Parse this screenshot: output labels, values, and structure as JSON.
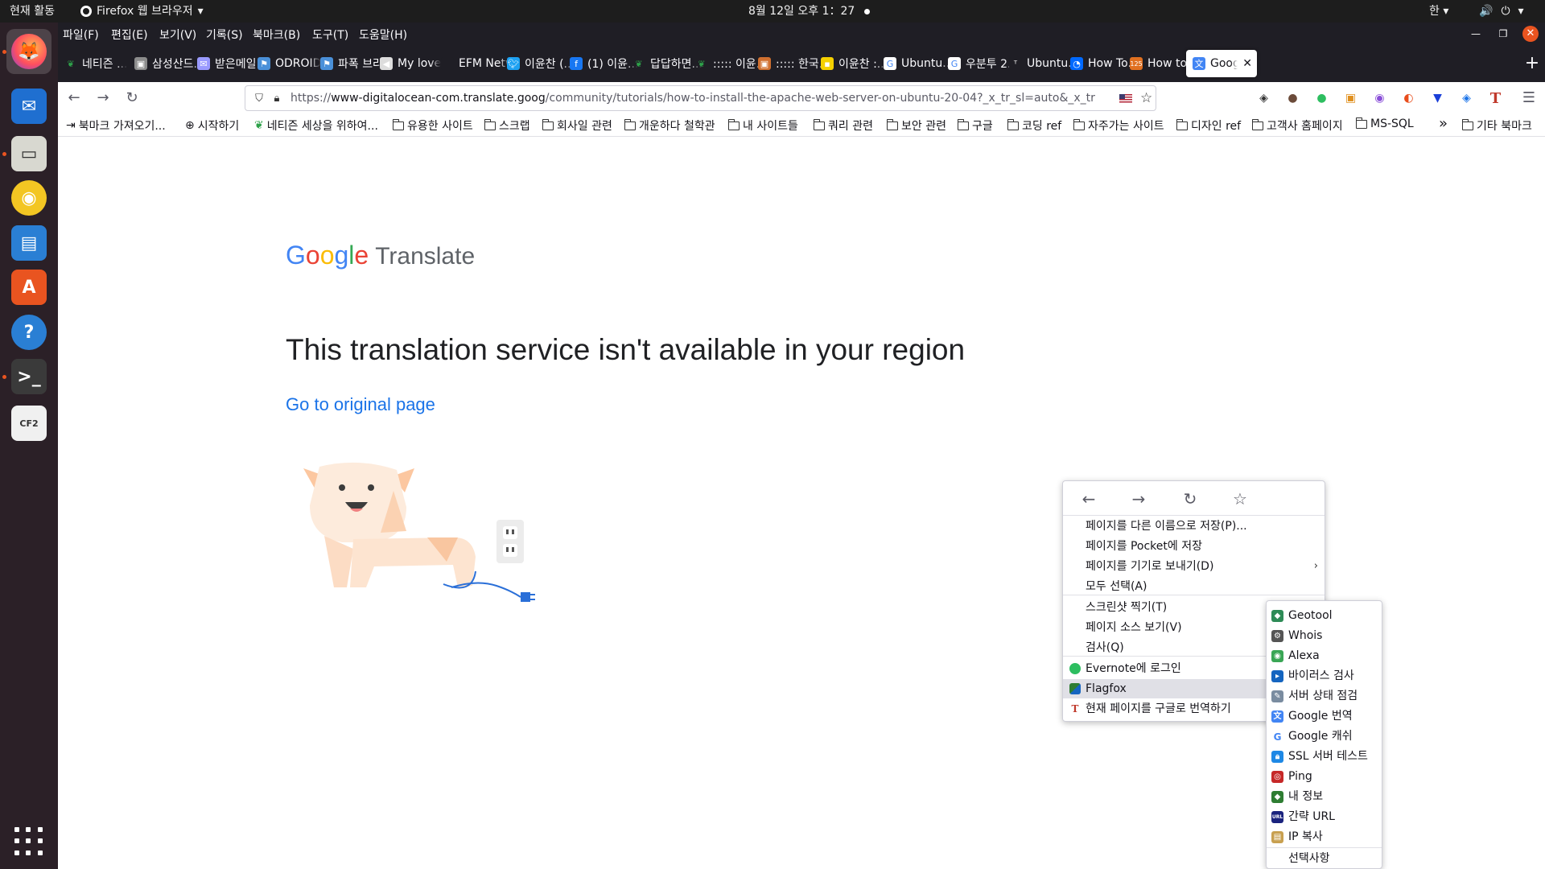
{
  "topbar": {
    "activities": "현재 활동",
    "app_menu": "Firefox 웹 브라우저",
    "clock": "8월 12일 오후 1：27",
    "input_method": "한"
  },
  "dock": {
    "apps": [
      {
        "name": "firefox-icon",
        "label": "Firefox",
        "color": "#ff7139"
      },
      {
        "name": "thunderbird-icon",
        "label": "Thunderbird",
        "color": "#1f6fd0"
      },
      {
        "name": "files-icon",
        "label": "Files",
        "color": "#d8d8d0"
      },
      {
        "name": "rhythmbox-icon",
        "label": "Rhythmbox",
        "color": "#f3c623"
      },
      {
        "name": "writer-icon",
        "label": "LibreOffice Writer",
        "color": "#2a7fd4"
      },
      {
        "name": "software-icon",
        "label": "Ubuntu Software",
        "color": "#e95420"
      },
      {
        "name": "help-icon",
        "label": "Help",
        "color": "#2a7fd4"
      },
      {
        "name": "terminal-icon",
        "label": "Terminal",
        "color": "#3a3a3a"
      },
      {
        "name": "cf2-icon",
        "label": "CF2",
        "color": "#f0f0f0"
      }
    ]
  },
  "menubar": {
    "items": [
      "파일(F)",
      "편집(E)",
      "보기(V)",
      "기록(S)",
      "북마크(B)",
      "도구(T)",
      "도움말(H)"
    ]
  },
  "tabs": [
    {
      "title": "네티즌 ...",
      "favicon": "sprout",
      "color": "#2ea24a"
    },
    {
      "title": "삼성산드...",
      "favicon": "image",
      "color": "#8c8c8c"
    },
    {
      "title": "받은메일...",
      "favicon": "mail",
      "color": "#9a9aff"
    },
    {
      "title": "ODROID",
      "favicon": "odroid",
      "color": "#4a90d9"
    },
    {
      "title": "파폭 브라...",
      "favicon": "odroid",
      "color": "#4a90d9"
    },
    {
      "title": "My love",
      "favicon": "speaker",
      "color": "#dddddd"
    },
    {
      "title": "EFM Netw...",
      "favicon": "none",
      "color": "#1f1e25"
    },
    {
      "title": "이윤찬 (...",
      "favicon": "twitter",
      "color": "#1da1f2"
    },
    {
      "title": "(1) 이윤...",
      "favicon": "facebook",
      "color": "#1877f2"
    },
    {
      "title": "답답하면...",
      "favicon": "sprout",
      "color": "#2ea24a"
    },
    {
      "title": "::::: 이윤...",
      "favicon": "sprout",
      "color": "#2ea24a"
    },
    {
      "title": "::::: 한국...",
      "favicon": "image",
      "color": "#d07030"
    },
    {
      "title": "이윤찬 :...",
      "favicon": "note",
      "color": "#f5d000"
    },
    {
      "title": "Ubuntu...",
      "favicon": "google",
      "color": "#ffffff"
    },
    {
      "title": "우분투 2...",
      "favicon": "google",
      "color": "#ffffff"
    },
    {
      "title": "Ubuntu...",
      "favicon": "t",
      "color": "#1f1e25"
    },
    {
      "title": "How To...",
      "favicon": "do",
      "color": "#0069ff"
    },
    {
      "title": "How to...",
      "favicon": "125",
      "color": "#e07020"
    },
    {
      "title": "Goog...",
      "favicon": "translate",
      "color": "#4285f4",
      "selected": true
    }
  ],
  "navbar": {
    "url_prefix": "https://",
    "url_host": "www-digitalocean-com.translate.goog",
    "url_path": "/community/tutorials/how-to-install-the-apache-web-server-on-ubuntu-20-04?_x_tr_sl=auto&_x_tr"
  },
  "extensions": [
    {
      "name": "pocket-icon",
      "glyph": "◈",
      "color": "#333333"
    },
    {
      "name": "profile-icon",
      "glyph": "●",
      "color": "#6b4b3a"
    },
    {
      "name": "evernote-icon",
      "glyph": "●",
      "color": "#2dbe60"
    },
    {
      "name": "image-ext-icon",
      "glyph": "▣",
      "color": "#e09020"
    },
    {
      "name": "color-ext-icon",
      "glyph": "◉",
      "color": "#8a4fd8"
    },
    {
      "name": "ublock-icon",
      "glyph": "◐",
      "color": "#e84d1c"
    },
    {
      "name": "download-ext-icon",
      "glyph": "▼",
      "color": "#1a3fd8"
    },
    {
      "name": "layers-ext-icon",
      "glyph": "◈",
      "color": "#1a73e8"
    },
    {
      "name": "translate-ext-icon",
      "glyph": "T",
      "color": "#c0392b"
    }
  ],
  "bookmarks": [
    {
      "label": "북마크 가져오기...",
      "icon": "import"
    },
    {
      "label": "시작하기",
      "icon": "globe"
    },
    {
      "label": "네티즌 세상을 위하여...",
      "icon": "sprout"
    },
    {
      "label": "유용한 사이트",
      "icon": "folder"
    },
    {
      "label": "스크랩",
      "icon": "folder"
    },
    {
      "label": "회사일 관련",
      "icon": "folder"
    },
    {
      "label": "개운하다 철학관",
      "icon": "folder"
    },
    {
      "label": "내 사이트들",
      "icon": "folder"
    },
    {
      "label": "쿼리 관련",
      "icon": "folder"
    },
    {
      "label": "보안 관련",
      "icon": "folder"
    },
    {
      "label": "구글",
      "icon": "folder"
    },
    {
      "label": "코딩 ref",
      "icon": "folder"
    },
    {
      "label": "자주가는 사이트",
      "icon": "folder"
    },
    {
      "label": "디자인 ref",
      "icon": "folder"
    },
    {
      "label": "고객사 홈페이지",
      "icon": "folder"
    },
    {
      "label": "MS-SQL",
      "icon": "folder"
    }
  ],
  "bookmarks_other": "기타 북마크",
  "page": {
    "logo_translate": "Translate",
    "heading": "This translation service isn't available in your region",
    "link": "Go to original page",
    "brand_colors": {
      "blue": "#4285f4",
      "red": "#ea4335",
      "yellow": "#fbbc05",
      "green": "#34a853"
    }
  },
  "context_menu": {
    "items": [
      {
        "label": "페이지를 다른 이름으로 저장(P)...",
        "submenu": false
      },
      {
        "label": "페이지를 Pocket에 저장",
        "submenu": false
      },
      {
        "label": "페이지를 기기로 보내기(D)",
        "submenu": true
      },
      {
        "label": "모두 선택(A)",
        "submenu": false
      },
      {
        "label": "스크린샷 찍기(T)",
        "submenu": false
      },
      {
        "label": "페이지 소스 보기(V)",
        "submenu": false
      },
      {
        "label": "검사(Q)",
        "submenu": false
      },
      {
        "label": "Evernote에 로그인",
        "submenu": false
      },
      {
        "label": "Flagfox",
        "submenu": true
      },
      {
        "label": "현재 페이지를 구글로 번역하기",
        "submenu": false
      }
    ]
  },
  "flagfox_menu": {
    "items": [
      {
        "label": "Geotool",
        "color": "#2e8b57"
      },
      {
        "label": "Whois",
        "color": "#555555"
      },
      {
        "label": "Alexa",
        "color": "#3aa655"
      },
      {
        "label": "바이러스 검사",
        "color": "#1565c0"
      },
      {
        "label": "서버 상태 점검",
        "color": "#7a8ca0"
      },
      {
        "label": "Google 번역",
        "color": "#4285f4"
      },
      {
        "label": "Google 캐쉬",
        "color": "#ffffff"
      },
      {
        "label": "SSL 서버 테스트",
        "color": "#1e88e5"
      },
      {
        "label": "Ping",
        "color": "#c62828"
      },
      {
        "label": "내 정보",
        "color": "#2e7d32"
      },
      {
        "label": "간략 URL",
        "color": "#1a237e"
      },
      {
        "label": "IP 복사",
        "color": "#c8a050"
      },
      {
        "label": "선택사항",
        "color": ""
      }
    ]
  }
}
